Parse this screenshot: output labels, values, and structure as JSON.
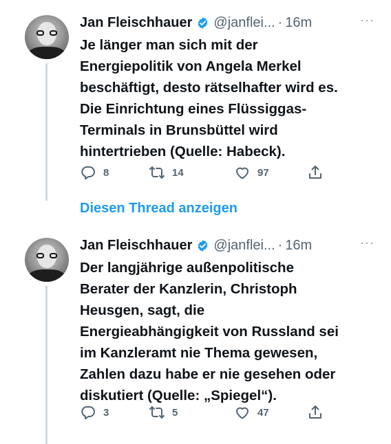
{
  "colors": {
    "accent": "#1d9bf0",
    "muted": "#536471",
    "text": "#0f1419"
  },
  "tweets": [
    {
      "name": "Jan Fleischhauer",
      "handle": "@janflei...",
      "dot": "·",
      "time": "16m",
      "more": "···",
      "text": "Je länger man sich mit der\nEnergiepolitik von Angela Merkel\nbeschäftigt, desto rätselhafter wird es.\nDie Einrichtung eines Flüssiggas-\nTerminals in Brunsbüttel wird\nhintertrieben (Quelle: Habeck).",
      "replies": "8",
      "retweets": "14",
      "likes": "97",
      "icons": [
        "verified-icon",
        "reply-icon",
        "retweet-icon",
        "like-icon",
        "share-icon"
      ]
    },
    {
      "name": "Jan Fleischhauer",
      "handle": "@janflei...",
      "dot": "·",
      "time": "16m",
      "more": "···",
      "text": "Der langjährige außenpolitische\nBerater der Kanzlerin, Christoph\nHeusgen, sagt, die\nEnergieabhängigkeit von Russland sei\nim Kanzleramt nie Thema gewesen,\nZahlen dazu habe er nie gesehen oder\ndiskutiert (Quelle: „Spiegel“).",
      "replies": "3",
      "retweets": "5",
      "likes": "47",
      "icons": [
        "verified-icon",
        "reply-icon",
        "retweet-icon",
        "like-icon",
        "share-icon"
      ]
    }
  ],
  "thread_link": "Diesen Thread anzeigen"
}
